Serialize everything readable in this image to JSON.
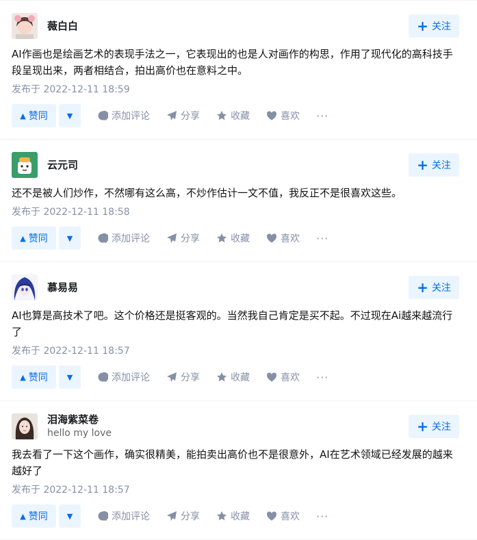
{
  "comments": [
    {
      "name": "薇白白",
      "bio": "",
      "content": "AI作画也是绘画艺术的表现手法之一，它表现出的也是人对画作的构思，作用了现代化的高科技手段呈现出来，两者相结合，拍出高价也在意料之中。",
      "time": "发布于 2022-12-11 18:59"
    },
    {
      "name": "云元司",
      "bio": "",
      "content": "还不是被人们炒作，不然哪有这么高，不炒作估计一文不值，我反正不是很喜欢这些。",
      "time": "发布于 2022-12-11 18:58"
    },
    {
      "name": "慕易易",
      "bio": "",
      "content": "AI也算是高技术了吧。这个价格还是挺客观的。当然我自己肯定是买不起。不过现在Ai越来越流行了",
      "time": "发布于 2022-12-11 18:57"
    },
    {
      "name": "泪海紫菜卷",
      "bio": "hello my love",
      "content": "我去看了一下这个画作，确实很精美，能拍卖出高价也不是很意外，AI在艺术领域已经发展的越来越好了",
      "time": "发布于 2022-12-11 18:57"
    }
  ],
  "labels": {
    "follow": "关注",
    "upvote": "赞同",
    "comment": "添加评论",
    "share": "分享",
    "favorite": "收藏",
    "like": "喜欢",
    "more": "···"
  },
  "icons": {
    "follow": "plus-icon",
    "upvote": "triangle-up-icon",
    "downvote": "triangle-down-icon",
    "comment": "comment-bubble-icon",
    "share": "paper-plane-icon",
    "favorite": "star-icon",
    "like": "heart-icon",
    "more": "ellipsis-icon"
  },
  "colors": {
    "accent": "#056de8",
    "accent_bg": "#ebf5ff",
    "muted": "#8590a6"
  }
}
